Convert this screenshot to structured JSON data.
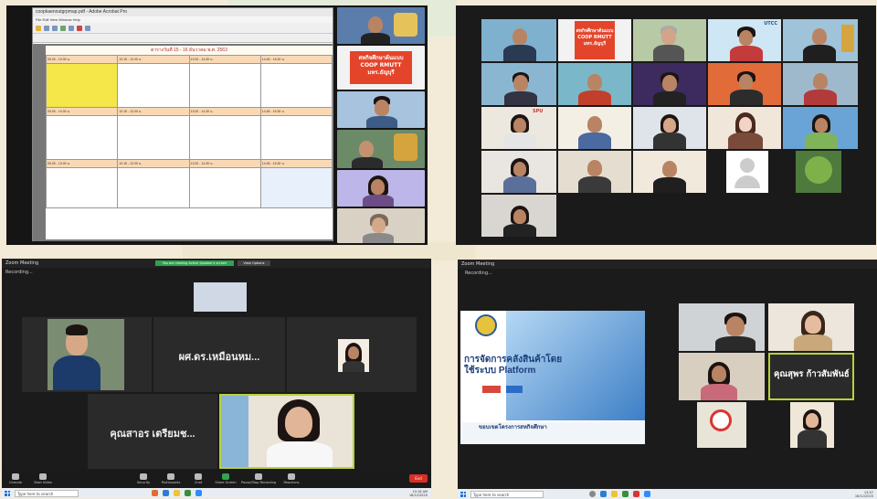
{
  "colors": {
    "background": "#f3ead7",
    "zoom_dark": "#1b1b1b",
    "zoom_green": "#2ea44f",
    "end_red": "#d93025",
    "thai_red": "#e4452a",
    "slide_blue": "#1c3f7a"
  },
  "panel1": {
    "pdf_title": "coopkaenoutgrpmap.pdf - Adobe Acrobat Pro",
    "menu": "File  Edit  View  Window  Help",
    "sheet_header": "ตารางวันที่ 15 - 16 ธันวาคม พ.ศ. 2563",
    "rows": [
      [
        "09.00 - 10.00 น.",
        "10.15 - 12.00 น.",
        "13.00 - 14.30 น.",
        "14.45 - 16.30 น."
      ],
      [
        "09.00 - 10.00 น.",
        "10.15 - 12.00 น.",
        "13.00 - 14.30 น.",
        "14.45 - 16.30 น."
      ],
      [
        "09.00 - 10.00 น.",
        "10.15 - 12.00 น.",
        "13.00 - 14.30 น.",
        "14.45 - 16.30 น."
      ]
    ],
    "logo_text": [
      "สหกิจศึกษาต้นแบบ",
      "COOP RMUTT",
      "มทร.ธัญบุรี"
    ]
  },
  "panel2": {
    "utcc_label": "UTCC",
    "red_logo": [
      "สหกิจศึกษาต้นแบบ",
      "COOP RMUTT",
      "มทร.ธัญบุรี"
    ],
    "spu_label": "SPU"
  },
  "panel3": {
    "window_title": "Zoom Meeting",
    "green_bar": "You are viewing Active Speaker's screen",
    "view_options": "View Options",
    "recording": "Recording...",
    "tile_names": [
      "ผศ.ดร.เหมือนหม...",
      "คุณสาอร เตรียมช..."
    ],
    "toolbar": [
      "Unmute",
      "Start Video",
      "Security",
      "Participants",
      "Chat",
      "Share Screen",
      "Pause/Stop Recording",
      "Reactions"
    ],
    "end_label": "End",
    "search_placeholder": "Type here to search",
    "clock": [
      "10:16 AM",
      "16/12/2020"
    ]
  },
  "panel4": {
    "window_title": "Zoom Meeting",
    "recording": "Recording...",
    "slide_title_1": "การจัดการคลังสินค้าโดย",
    "slide_title_2": "ใช้ระบบ Platform",
    "slide_footer": "ขอบเขตโครงการสหกิจศึกษา",
    "big_name": "คุณสุพร ก้าวสัมพันธ์",
    "search_placeholder": "Type here to search",
    "clock": [
      "13:57",
      "16/12/2020"
    ]
  }
}
